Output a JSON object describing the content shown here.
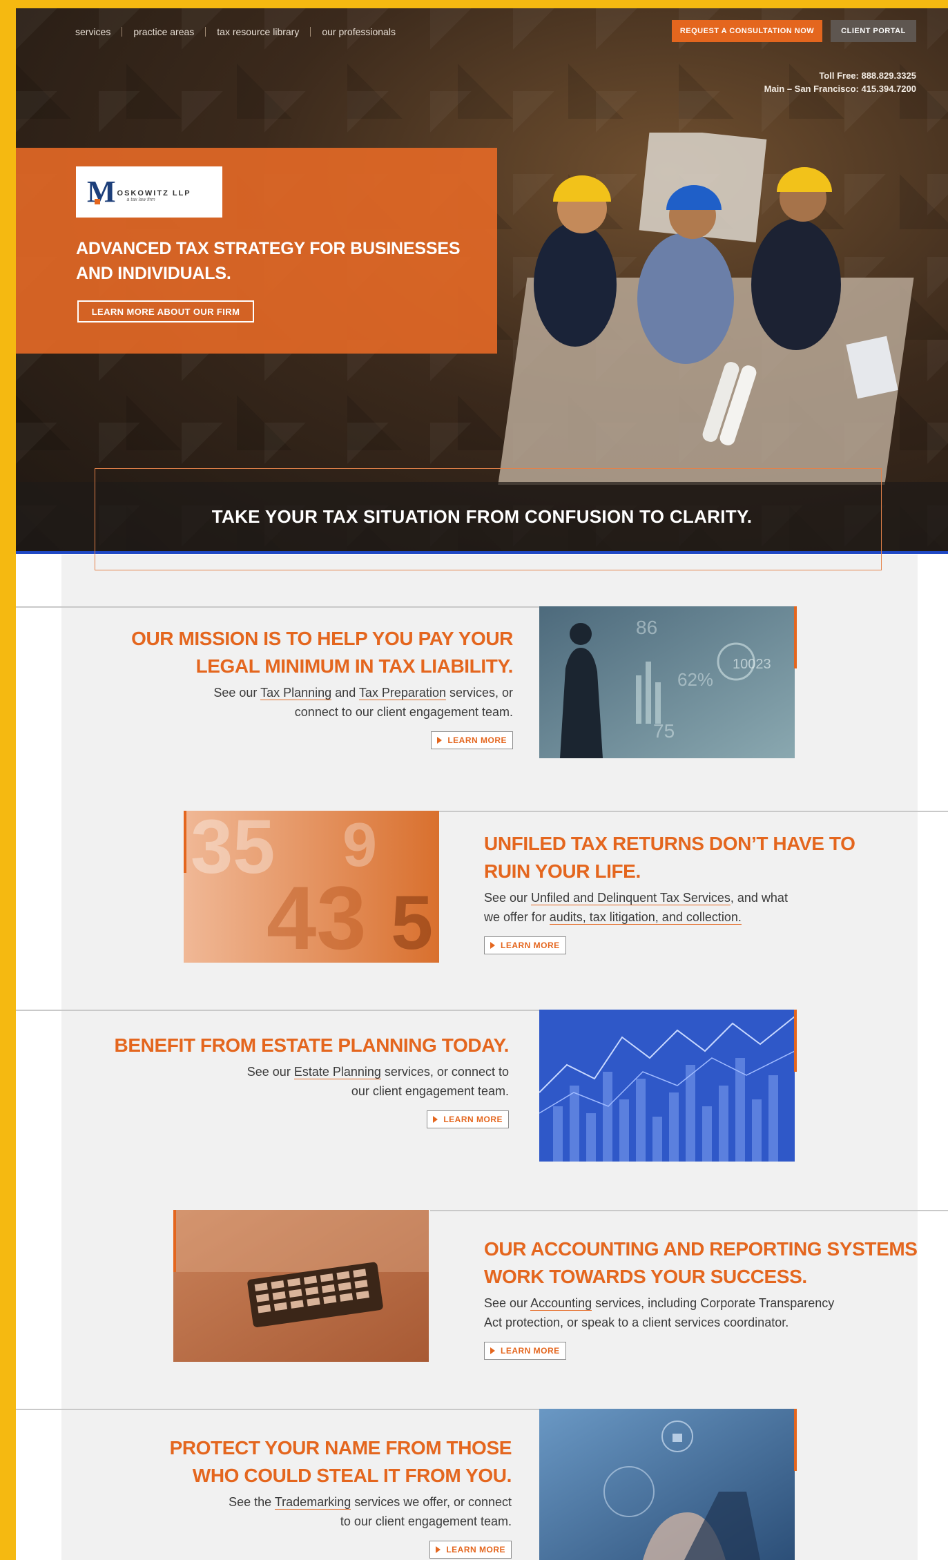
{
  "nav": {
    "items": [
      "services",
      "practice areas",
      "tax resource library",
      "our professionals"
    ],
    "consult_label": "REQUEST A CONSULTATION NOW",
    "portal_label": "CLIENT PORTAL"
  },
  "contact": {
    "toll_free": "Toll Free: 888.829.3325",
    "main": "Main – San Francisco: 415.394.7200"
  },
  "hero": {
    "logo_name": "OSKOWITZ LLP",
    "logo_tag": "a tax law firm",
    "headline": "ADVANCED TAX STRATEGY FOR BUSINESSES AND INDIVIDUALS.",
    "learn_firm_label": "LEARN MORE ABOUT OUR FIRM",
    "tagline": "TAKE YOUR TAX SITUATION FROM CONFUSION TO CLARITY."
  },
  "learn_more_label": "LEARN MORE",
  "sections": [
    {
      "title_lines": [
        "OUR MISSION IS TO HELP YOU PAY YOUR",
        "LEGAL MINIMUM IN TAX LIABILITY."
      ],
      "desc": {
        "pre": "See our ",
        "link1": "Tax Planning",
        "mid": " and ",
        "link2": "Tax Preparation",
        "post1": " services, or",
        "line2": "connect to our client engagement team."
      }
    },
    {
      "title_lines": [
        "UNFILED TAX RETURNS DON’T HAVE TO",
        "RUIN YOUR LIFE."
      ],
      "desc": {
        "pre": "See our ",
        "link1": "Unfiled and Delinquent Tax Services",
        "post1": ", and what",
        "line2_pre": "we offer for ",
        "link2": "audits, tax litigation, and collection."
      }
    },
    {
      "title_lines": [
        "BENEFIT FROM ESTATE PLANNING TODAY."
      ],
      "desc": {
        "pre": "See our ",
        "link1": "Estate Planning",
        "post1": " services, or connect to",
        "line2": "our client engagement team."
      }
    },
    {
      "title_lines": [
        "OUR ACCOUNTING AND REPORTING SYSTEMS",
        "WORK TOWARDS YOUR SUCCESS."
      ],
      "desc": {
        "pre": "See our ",
        "link1": "Accounting",
        "post1": " services, including Corporate Transparency",
        "line2": "Act protection, or speak to a client services coordinator."
      }
    },
    {
      "title_lines": [
        "PROTECT YOUR NAME FROM THOSE",
        "WHO COULD STEAL IT FROM YOU."
      ],
      "desc": {
        "pre": "See the ",
        "link1": "Trademarking",
        "post1": " services we offer, or connect",
        "line2": "to our client engagement team."
      }
    }
  ],
  "image_labels": {
    "mission_numbers": [
      "86",
      "62%",
      "10023",
      "75"
    ]
  },
  "colors": {
    "accent": "#e4661e",
    "frame": "#f5b911",
    "navy": "#1d3f7a",
    "blue_rule": "#1f48c4"
  }
}
